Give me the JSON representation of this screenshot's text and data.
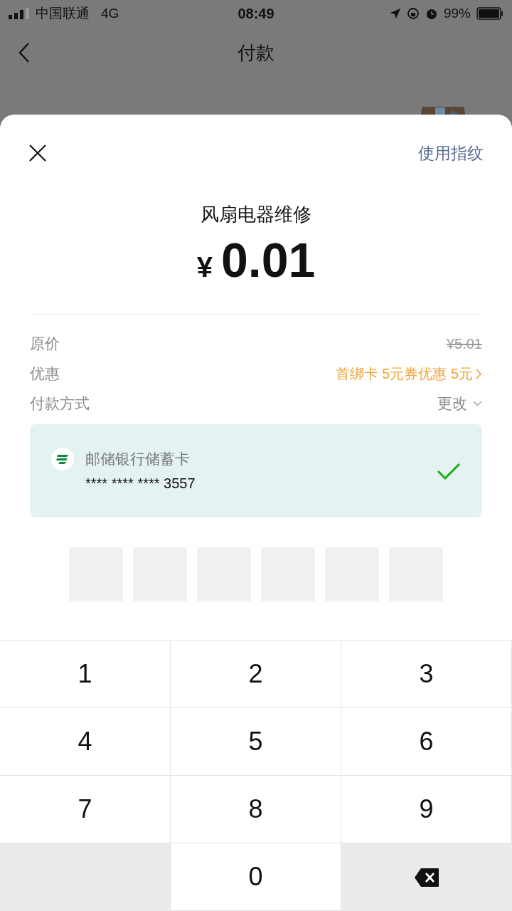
{
  "status_bar": {
    "carrier": "中国联通",
    "network": "4G",
    "time": "08:49",
    "battery": "99%"
  },
  "nav": {
    "title": "付款"
  },
  "sheet": {
    "fingerprint_link": "使用指纹",
    "merchant": "风扇电器维修",
    "currency": "¥",
    "amount": "0.01",
    "rows": [
      {
        "kind": "strike",
        "label": "原价",
        "value": "¥5.01"
      },
      {
        "kind": "promo",
        "label": "优惠",
        "value": "首绑卡 5元券优惠 5元"
      },
      {
        "kind": "change",
        "label": "付款方式",
        "value": "更改"
      }
    ],
    "card": {
      "name": "邮储银行储蓄卡",
      "number": "**** **** **** 3557",
      "selected": true
    },
    "pin_boxes": [
      {
        "filled": false
      },
      {
        "filled": false
      },
      {
        "filled": false
      },
      {
        "filled": false
      },
      {
        "filled": false
      },
      {
        "filled": false
      }
    ]
  },
  "keypad": [
    {
      "kind": "digit",
      "label": "1"
    },
    {
      "kind": "digit",
      "label": "2"
    },
    {
      "kind": "digit",
      "label": "3"
    },
    {
      "kind": "digit",
      "label": "4"
    },
    {
      "kind": "digit",
      "label": "5"
    },
    {
      "kind": "digit",
      "label": "6"
    },
    {
      "kind": "digit",
      "label": "7"
    },
    {
      "kind": "digit",
      "label": "8"
    },
    {
      "kind": "digit",
      "label": "9"
    },
    {
      "kind": "blank"
    },
    {
      "kind": "digit",
      "label": "0"
    },
    {
      "kind": "delete"
    }
  ]
}
